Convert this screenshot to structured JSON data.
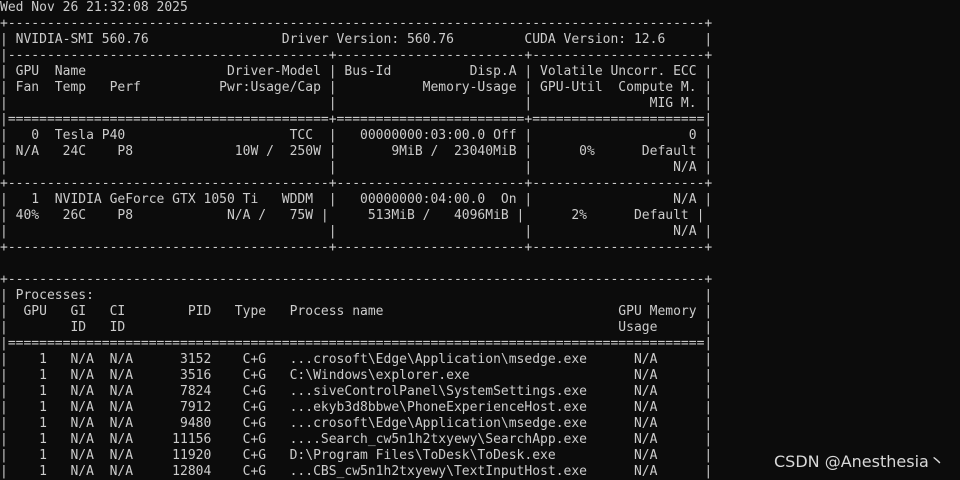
{
  "colors": {
    "background": "#0c0c0c",
    "text": "#cccccc"
  },
  "terminal": {
    "lines": [
      "Wed Nov 26 21:32:08 2025",
      "+-----------------------------------------------------------------------------------------+",
      "| NVIDIA-SMI 560.76                 Driver Version: 560.76         CUDA Version: 12.6     |",
      "|-----------------------------------------+------------------------+----------------------+",
      "| GPU  Name                  Driver-Model | Bus-Id          Disp.A | Volatile Uncorr. ECC |",
      "| Fan  Temp   Perf          Pwr:Usage/Cap |           Memory-Usage | GPU-Util  Compute M. |",
      "|                                         |                        |               MIG M. |",
      "|=========================================+========================+======================|",
      "|   0  Tesla P40                     TCC  |   00000000:03:00.0 Off |                    0 |",
      "| N/A   24C    P8             10W /  250W |       9MiB /  23040MiB |      0%      Default |",
      "|                                         |                        |                  N/A |",
      "+-----------------------------------------+------------------------+----------------------+",
      "|   1  NVIDIA GeForce GTX 1050 Ti   WDDM  |   00000000:04:00.0  On |                  N/A |",
      "| 40%   26C    P8            N/A /   75W |     513MiB /   4096MiB |      2%      Default |",
      "|                                         |                        |                  N/A |",
      "+-----------------------------------------+------------------------+----------------------+",
      "",
      "+-----------------------------------------------------------------------------------------+",
      "| Processes:                                                                              |",
      "|  GPU   GI   CI        PID   Type   Process name                              GPU Memory |",
      "|        ID   ID                                                               Usage      |",
      "|=========================================================================================|",
      "|    1   N/A  N/A      3152    C+G   ...crosoft\\Edge\\Application\\msedge.exe      N/A      |",
      "|    1   N/A  N/A      3516    C+G   C:\\Windows\\explorer.exe                     N/A      |",
      "|    1   N/A  N/A      7824    C+G   ...siveControlPanel\\SystemSettings.exe      N/A      |",
      "|    1   N/A  N/A      7912    C+G   ...ekyb3d8bbwe\\PhoneExperienceHost.exe      N/A      |",
      "|    1   N/A  N/A      9480    C+G   ...crosoft\\Edge\\Application\\msedge.exe      N/A      |",
      "|    1   N/A  N/A     11156    C+G   ....Search_cw5n1h2txyewy\\SearchApp.exe      N/A      |",
      "|    1   N/A  N/A     11920    C+G   D:\\Program Files\\ToDesk\\ToDesk.exe          N/A      |",
      "|    1   N/A  N/A     12804    C+G   ...CBS_cw5n1h2txyewy\\TextInputHost.exe      N/A      |"
    ]
  },
  "watermark": {
    "text": "CSDN @Anesthesia丶"
  }
}
